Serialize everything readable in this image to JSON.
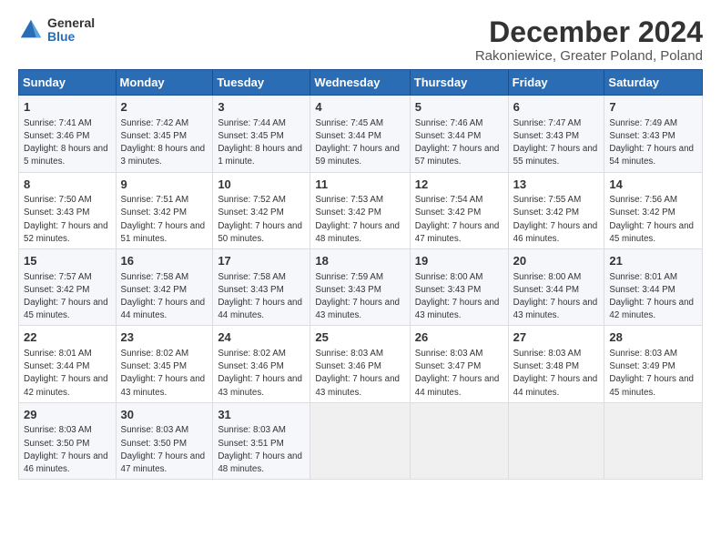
{
  "logo": {
    "general": "General",
    "blue": "Blue"
  },
  "title": "December 2024",
  "subtitle": "Rakoniewice, Greater Poland, Poland",
  "days_of_week": [
    "Sunday",
    "Monday",
    "Tuesday",
    "Wednesday",
    "Thursday",
    "Friday",
    "Saturday"
  ],
  "weeks": [
    [
      {
        "day": "1",
        "sunrise": "7:41 AM",
        "sunset": "3:46 PM",
        "daylight": "8 hours and 5 minutes."
      },
      {
        "day": "2",
        "sunrise": "7:42 AM",
        "sunset": "3:45 PM",
        "daylight": "8 hours and 3 minutes."
      },
      {
        "day": "3",
        "sunrise": "7:44 AM",
        "sunset": "3:45 PM",
        "daylight": "8 hours and 1 minute."
      },
      {
        "day": "4",
        "sunrise": "7:45 AM",
        "sunset": "3:44 PM",
        "daylight": "7 hours and 59 minutes."
      },
      {
        "day": "5",
        "sunrise": "7:46 AM",
        "sunset": "3:44 PM",
        "daylight": "7 hours and 57 minutes."
      },
      {
        "day": "6",
        "sunrise": "7:47 AM",
        "sunset": "3:43 PM",
        "daylight": "7 hours and 55 minutes."
      },
      {
        "day": "7",
        "sunrise": "7:49 AM",
        "sunset": "3:43 PM",
        "daylight": "7 hours and 54 minutes."
      }
    ],
    [
      {
        "day": "8",
        "sunrise": "7:50 AM",
        "sunset": "3:43 PM",
        "daylight": "7 hours and 52 minutes."
      },
      {
        "day": "9",
        "sunrise": "7:51 AM",
        "sunset": "3:42 PM",
        "daylight": "7 hours and 51 minutes."
      },
      {
        "day": "10",
        "sunrise": "7:52 AM",
        "sunset": "3:42 PM",
        "daylight": "7 hours and 50 minutes."
      },
      {
        "day": "11",
        "sunrise": "7:53 AM",
        "sunset": "3:42 PM",
        "daylight": "7 hours and 48 minutes."
      },
      {
        "day": "12",
        "sunrise": "7:54 AM",
        "sunset": "3:42 PM",
        "daylight": "7 hours and 47 minutes."
      },
      {
        "day": "13",
        "sunrise": "7:55 AM",
        "sunset": "3:42 PM",
        "daylight": "7 hours and 46 minutes."
      },
      {
        "day": "14",
        "sunrise": "7:56 AM",
        "sunset": "3:42 PM",
        "daylight": "7 hours and 45 minutes."
      }
    ],
    [
      {
        "day": "15",
        "sunrise": "7:57 AM",
        "sunset": "3:42 PM",
        "daylight": "7 hours and 45 minutes."
      },
      {
        "day": "16",
        "sunrise": "7:58 AM",
        "sunset": "3:42 PM",
        "daylight": "7 hours and 44 minutes."
      },
      {
        "day": "17",
        "sunrise": "7:58 AM",
        "sunset": "3:43 PM",
        "daylight": "7 hours and 44 minutes."
      },
      {
        "day": "18",
        "sunrise": "7:59 AM",
        "sunset": "3:43 PM",
        "daylight": "7 hours and 43 minutes."
      },
      {
        "day": "19",
        "sunrise": "8:00 AM",
        "sunset": "3:43 PM",
        "daylight": "7 hours and 43 minutes."
      },
      {
        "day": "20",
        "sunrise": "8:00 AM",
        "sunset": "3:44 PM",
        "daylight": "7 hours and 43 minutes."
      },
      {
        "day": "21",
        "sunrise": "8:01 AM",
        "sunset": "3:44 PM",
        "daylight": "7 hours and 42 minutes."
      }
    ],
    [
      {
        "day": "22",
        "sunrise": "8:01 AM",
        "sunset": "3:44 PM",
        "daylight": "7 hours and 42 minutes."
      },
      {
        "day": "23",
        "sunrise": "8:02 AM",
        "sunset": "3:45 PM",
        "daylight": "7 hours and 43 minutes."
      },
      {
        "day": "24",
        "sunrise": "8:02 AM",
        "sunset": "3:46 PM",
        "daylight": "7 hours and 43 minutes."
      },
      {
        "day": "25",
        "sunrise": "8:03 AM",
        "sunset": "3:46 PM",
        "daylight": "7 hours and 43 minutes."
      },
      {
        "day": "26",
        "sunrise": "8:03 AM",
        "sunset": "3:47 PM",
        "daylight": "7 hours and 44 minutes."
      },
      {
        "day": "27",
        "sunrise": "8:03 AM",
        "sunset": "3:48 PM",
        "daylight": "7 hours and 44 minutes."
      },
      {
        "day": "28",
        "sunrise": "8:03 AM",
        "sunset": "3:49 PM",
        "daylight": "7 hours and 45 minutes."
      }
    ],
    [
      {
        "day": "29",
        "sunrise": "8:03 AM",
        "sunset": "3:50 PM",
        "daylight": "7 hours and 46 minutes."
      },
      {
        "day": "30",
        "sunrise": "8:03 AM",
        "sunset": "3:50 PM",
        "daylight": "7 hours and 47 minutes."
      },
      {
        "day": "31",
        "sunrise": "8:03 AM",
        "sunset": "3:51 PM",
        "daylight": "7 hours and 48 minutes."
      },
      null,
      null,
      null,
      null
    ]
  ],
  "labels": {
    "sunrise": "Sunrise:",
    "sunset": "Sunset:",
    "daylight": "Daylight:"
  }
}
